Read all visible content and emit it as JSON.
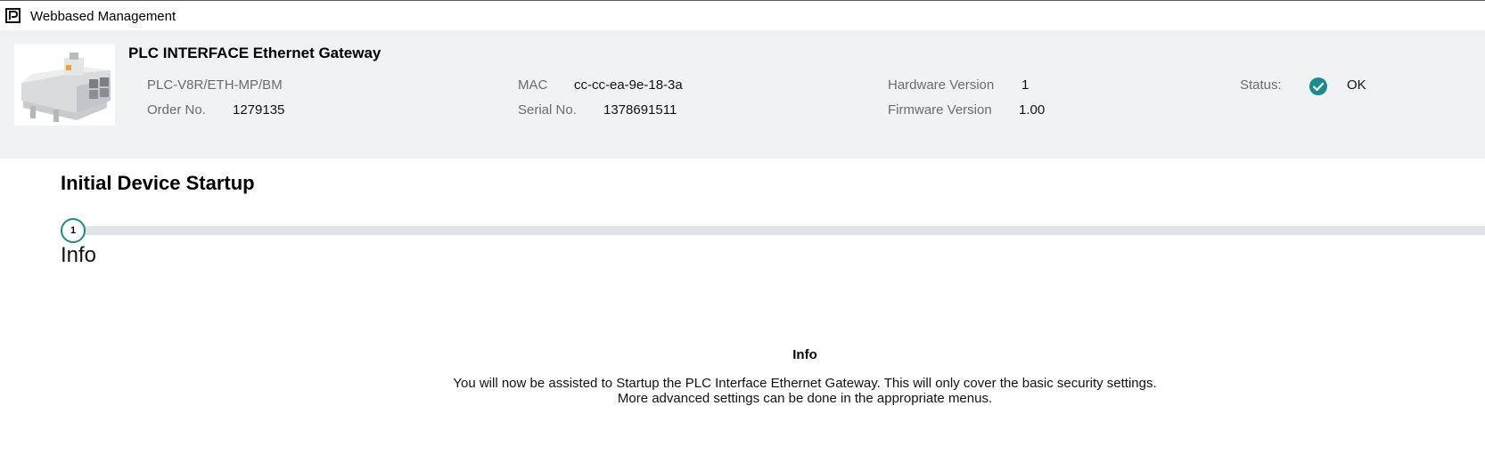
{
  "window": {
    "title": "Webbased Management",
    "icon": "phoenix-logo-icon"
  },
  "device": {
    "name": "PLC INTERFACE Ethernet Gateway",
    "model": "PLC-V8R/ETH-MP/BM",
    "order_label": "Order No.",
    "order_value": "1279135",
    "mac_label": "MAC",
    "mac_value": "cc-cc-ea-9e-18-3a",
    "serial_label": "Serial No.",
    "serial_value": "1378691511",
    "hw_label": "Hardware Version",
    "hw_value": "1",
    "fw_label": "Firmware Version",
    "fw_value": "1.00",
    "status_label": "Status:",
    "status_value": "OK",
    "status_icon": "check-circle-icon",
    "status_color": "#1a8c8c"
  },
  "page": {
    "title": "Initial Device Startup"
  },
  "stepper": {
    "steps": [
      {
        "number": "1",
        "label": "Info"
      }
    ],
    "accent": "#1a8c8c"
  },
  "info": {
    "title": "Info",
    "line1": "You will now be assisted to Startup the PLC Interface Ethernet Gateway. This will only cover the basic security settings.",
    "line2": "More advanced settings can be done in the appropriate menus."
  }
}
